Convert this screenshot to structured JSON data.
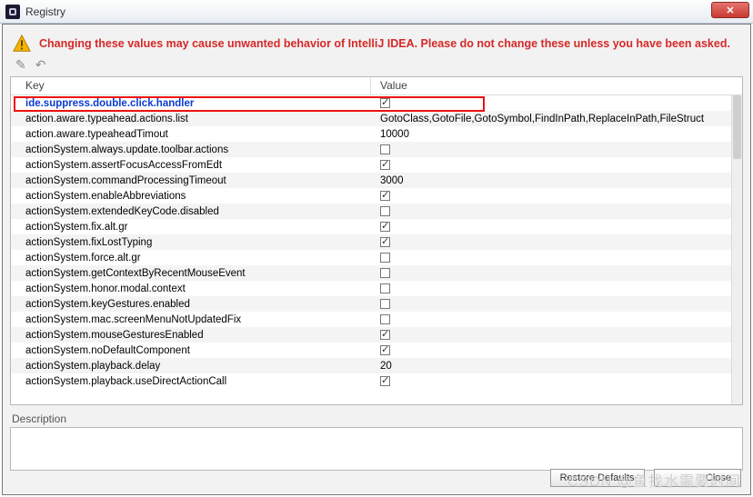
{
  "title": "Registry",
  "warning": "Changing these values may cause unwanted behavior of IntelliJ IDEA. Please do not change these unless you have been asked.",
  "columns": {
    "key": "Key",
    "value": "Value"
  },
  "rows": [
    {
      "key": "ide.suppress.double.click.handler",
      "type": "check",
      "checked": true,
      "selected": true
    },
    {
      "key": "action.aware.typeahead.actions.list",
      "type": "text",
      "value": "GotoClass,GotoFile,GotoSymbol,FindInPath,ReplaceInPath,FileStruct"
    },
    {
      "key": "action.aware.typeaheadTimout",
      "type": "text",
      "value": "10000"
    },
    {
      "key": "actionSystem.always.update.toolbar.actions",
      "type": "check",
      "checked": false
    },
    {
      "key": "actionSystem.assertFocusAccessFromEdt",
      "type": "check",
      "checked": true
    },
    {
      "key": "actionSystem.commandProcessingTimeout",
      "type": "text",
      "value": "3000"
    },
    {
      "key": "actionSystem.enableAbbreviations",
      "type": "check",
      "checked": true
    },
    {
      "key": "actionSystem.extendedKeyCode.disabled",
      "type": "check",
      "checked": false
    },
    {
      "key": "actionSystem.fix.alt.gr",
      "type": "check",
      "checked": true
    },
    {
      "key": "actionSystem.fixLostTyping",
      "type": "check",
      "checked": true
    },
    {
      "key": "actionSystem.force.alt.gr",
      "type": "check",
      "checked": false
    },
    {
      "key": "actionSystem.getContextByRecentMouseEvent",
      "type": "check",
      "checked": false
    },
    {
      "key": "actionSystem.honor.modal.context",
      "type": "check",
      "checked": false
    },
    {
      "key": "actionSystem.keyGestures.enabled",
      "type": "check",
      "checked": false
    },
    {
      "key": "actionSystem.mac.screenMenuNotUpdatedFix",
      "type": "check",
      "checked": false
    },
    {
      "key": "actionSystem.mouseGesturesEnabled",
      "type": "check",
      "checked": true
    },
    {
      "key": "actionSystem.noDefaultComponent",
      "type": "check",
      "checked": true
    },
    {
      "key": "actionSystem.playback.delay",
      "type": "text",
      "value": "20"
    },
    {
      "key": "actionSystem.playback.useDirectActionCall",
      "type": "check",
      "checked": true
    }
  ],
  "desc_label": "Description",
  "buttons": {
    "restore": "Restore Defaults",
    "close": "Close"
  },
  "watermark": "CSDN @鱼找水需要时间"
}
